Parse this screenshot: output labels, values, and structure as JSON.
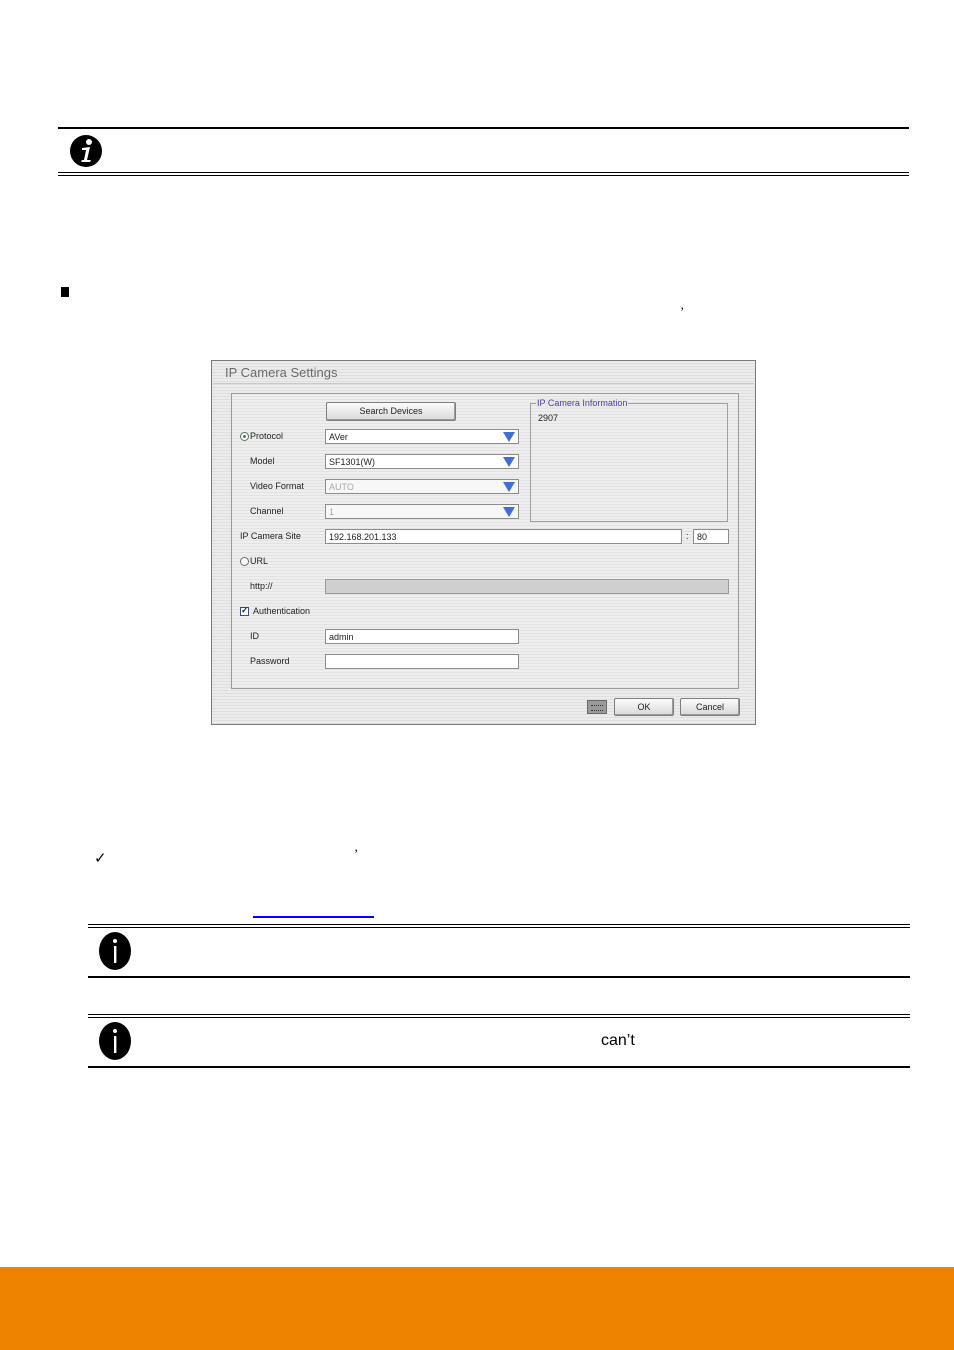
{
  "page": {
    "accent_color": "#ee8300",
    "link_color": "#0000ff",
    "notes": [
      {
        "icon": "info-icon",
        "text": ""
      },
      {
        "icon": "info-icon",
        "text": ""
      },
      {
        "icon": "info-icon",
        "text": "can’t"
      }
    ],
    "stray_apostrophe_1": "’",
    "stray_apostrophe_2": "’",
    "bullet_glyph": "■",
    "check_glyph": "✓"
  },
  "dialog": {
    "title": "IP Camera Settings",
    "search_button": "Search Devices",
    "protocol": {
      "label": "Protocol",
      "value": "AVer",
      "selected": true
    },
    "model": {
      "label": "Model",
      "value": "SF1301(W)"
    },
    "video_format": {
      "label": "Video Format",
      "value": "AUTO"
    },
    "channel": {
      "label": "Channel",
      "value": "1"
    },
    "ip_camera_site": {
      "label": "IP Camera Site",
      "value": "192.168.201.133",
      "separator": ":",
      "port": "80"
    },
    "url": {
      "label": "URL",
      "selected": false,
      "prefix_label": "http://",
      "value": ""
    },
    "authentication": {
      "label": "Authentication",
      "checked": true
    },
    "id": {
      "label": "ID",
      "value": "admin"
    },
    "password": {
      "label": "Password",
      "value": ""
    },
    "info_group": {
      "title": "IP Camera Information",
      "value": "2907"
    },
    "ok_button": "OK",
    "cancel_button": "Cancel"
  }
}
